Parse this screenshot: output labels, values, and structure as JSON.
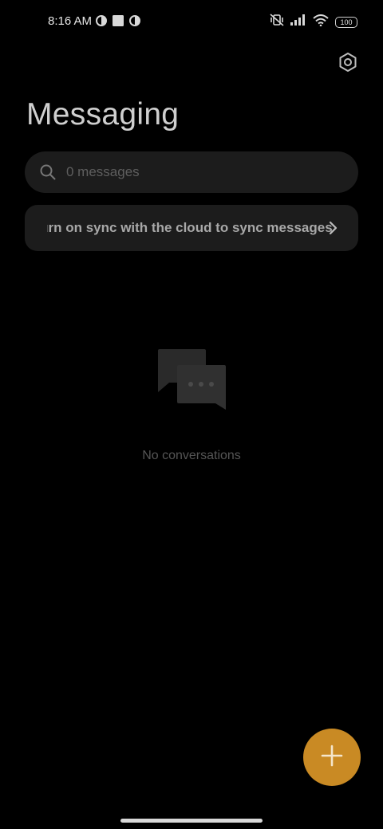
{
  "status_bar": {
    "time": "8:16 AM",
    "battery": "100",
    "left_icons": [
      "data-saver-icon",
      "square-notification-icon",
      "data-saver-icon"
    ],
    "right_icons": [
      "mute-vibrate-icon",
      "signal-icon",
      "wifi-icon",
      "battery-icon"
    ]
  },
  "header": {
    "title": "Messaging",
    "settings_icon": "settings-icon"
  },
  "search": {
    "placeholder": "0 messages",
    "icon": "search-icon"
  },
  "sync_banner": {
    "text": "Turn on sync with the cloud to sync messages",
    "chevron_icon": "chevron-right-icon"
  },
  "empty_state": {
    "icon": "chat-bubbles-icon",
    "text": "No conversations"
  },
  "fab": {
    "icon": "plus-icon",
    "color": "#c98a24"
  },
  "colors": {
    "background": "#000000",
    "surface": "#1c1c1c",
    "accent": "#c98a24"
  }
}
